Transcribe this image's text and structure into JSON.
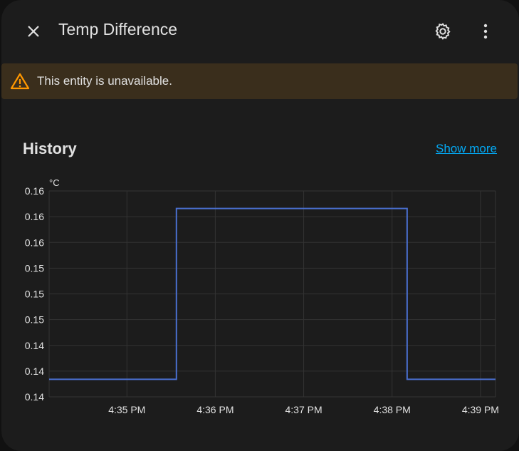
{
  "header": {
    "title": "Temp Difference",
    "close_icon": "close-icon",
    "settings_icon": "gear-icon",
    "menu_icon": "dots-vertical-icon"
  },
  "alert": {
    "text": "This entity is unavailable.",
    "icon": "warning-icon",
    "color": "#ff9800"
  },
  "history": {
    "title": "History",
    "show_more": "Show more"
  },
  "chart_data": {
    "type": "line",
    "step": true,
    "unit": "°C",
    "ylabel": "°C",
    "xlabel": "",
    "ylim": [
      0.14,
      0.16
    ],
    "yticks": [
      0.14,
      0.1425,
      0.145,
      0.1475,
      0.15,
      0.1525,
      0.155,
      0.1575,
      0.16
    ],
    "ytick_labels": [
      "0.14",
      "0.14",
      "0.14",
      "0.15",
      "0.15",
      "0.15",
      "0.16",
      "0.16",
      "0.16"
    ],
    "xlim_minutes_after_4pm": [
      34.12,
      39.17
    ],
    "xticks_minutes_after_4pm": [
      35,
      36,
      37,
      38,
      39
    ],
    "xtick_labels": [
      "4:35 PM",
      "4:36 PM",
      "4:37 PM",
      "4:38 PM",
      "4:39 PM"
    ],
    "grid": true,
    "series": [
      {
        "name": "Temp Difference",
        "color": "#4a6fd0",
        "points": [
          [
            34.12,
            0.1417
          ],
          [
            35.56,
            0.1417
          ],
          [
            35.56,
            0.1583
          ],
          [
            38.17,
            0.1583
          ],
          [
            38.17,
            0.1417
          ],
          [
            39.17,
            0.1417
          ]
        ]
      }
    ]
  }
}
